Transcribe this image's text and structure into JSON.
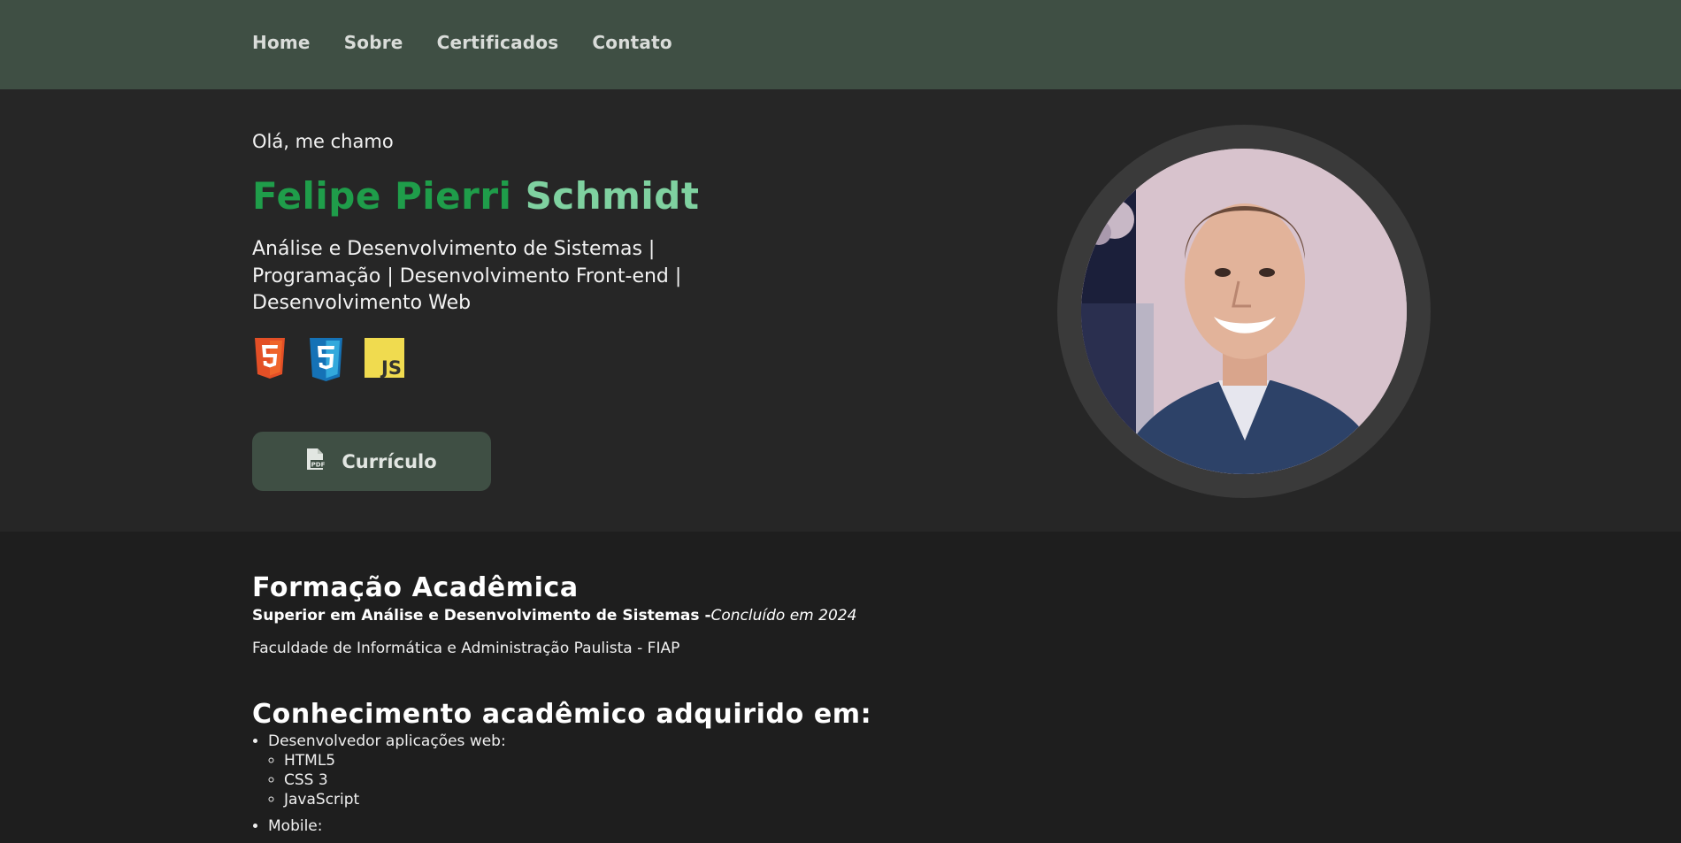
{
  "nav": {
    "items": [
      {
        "label": "Home"
      },
      {
        "label": "Sobre"
      },
      {
        "label": "Certificados"
      },
      {
        "label": "Contato"
      }
    ]
  },
  "hero": {
    "greeting": "Olá, me chamo",
    "name_first": "Felipe Pierri",
    "name_last": "Schmidt",
    "roles": "Análise e Desenvolvimento de Sistemas | Programação | Desenvolvimento Front-end | Desenvolvimento Web",
    "tech_icons": [
      "html5-icon",
      "css3-icon",
      "javascript-icon"
    ],
    "cv_button_label": "Currículo",
    "cv_icon": "pdf-file-icon"
  },
  "education": {
    "title": "Formação Acadêmica",
    "degree": "Superior em Análise e Desenvolvimento de Sistemas -",
    "status": "Concluído em 2024",
    "school": "Faculdade de Informática e Administração Paulista - FIAP"
  },
  "knowledge": {
    "title": "Conhecimento acadêmico adquirido em:",
    "items": [
      {
        "label": "Desenvolvedor aplicações web:",
        "subitems": [
          "HTML5",
          "CSS 3",
          "JavaScript"
        ]
      },
      {
        "label": "Mobile:"
      }
    ]
  },
  "colors": {
    "nav_bg": "#3f4f44",
    "hero_bg": "#262626",
    "page_bg": "#1e1e1e",
    "name_green": "#1f9d4a",
    "name_light_green": "#7fd1a0",
    "button_bg": "#3f4f44"
  }
}
